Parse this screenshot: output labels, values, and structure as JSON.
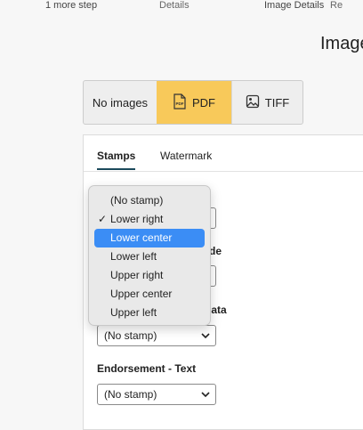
{
  "steps": [
    {
      "label": "1 more step"
    },
    {
      "label": "Details"
    },
    {
      "label": "Image Details"
    },
    {
      "label": "Re"
    }
  ],
  "page": {
    "title": "Image"
  },
  "format": {
    "options": [
      {
        "label": "No images",
        "icon": null
      },
      {
        "label": "PDF",
        "icon": "pdf-file-icon",
        "selected": true,
        "color": "#f8c95a"
      },
      {
        "label": "TIFF",
        "icon": "image-icon"
      }
    ]
  },
  "tabs": [
    {
      "label": "Stamps",
      "active": true
    },
    {
      "label": "Watermark"
    }
  ],
  "fields": [
    {
      "label": "de",
      "value": ""
    },
    {
      "label": "data",
      "value": "(No stamp)"
    },
    {
      "label": "Endorsement - Text",
      "value": "(No stamp)"
    }
  ],
  "dropdown": {
    "items": [
      {
        "label": "(No stamp)"
      },
      {
        "label": "Lower right",
        "checked": true
      },
      {
        "label": "Lower center",
        "highlighted": true
      },
      {
        "label": "Lower left"
      },
      {
        "label": "Upper right"
      },
      {
        "label": "Upper center"
      },
      {
        "label": "Upper left"
      }
    ],
    "highlight_color": "#3b8df5"
  }
}
